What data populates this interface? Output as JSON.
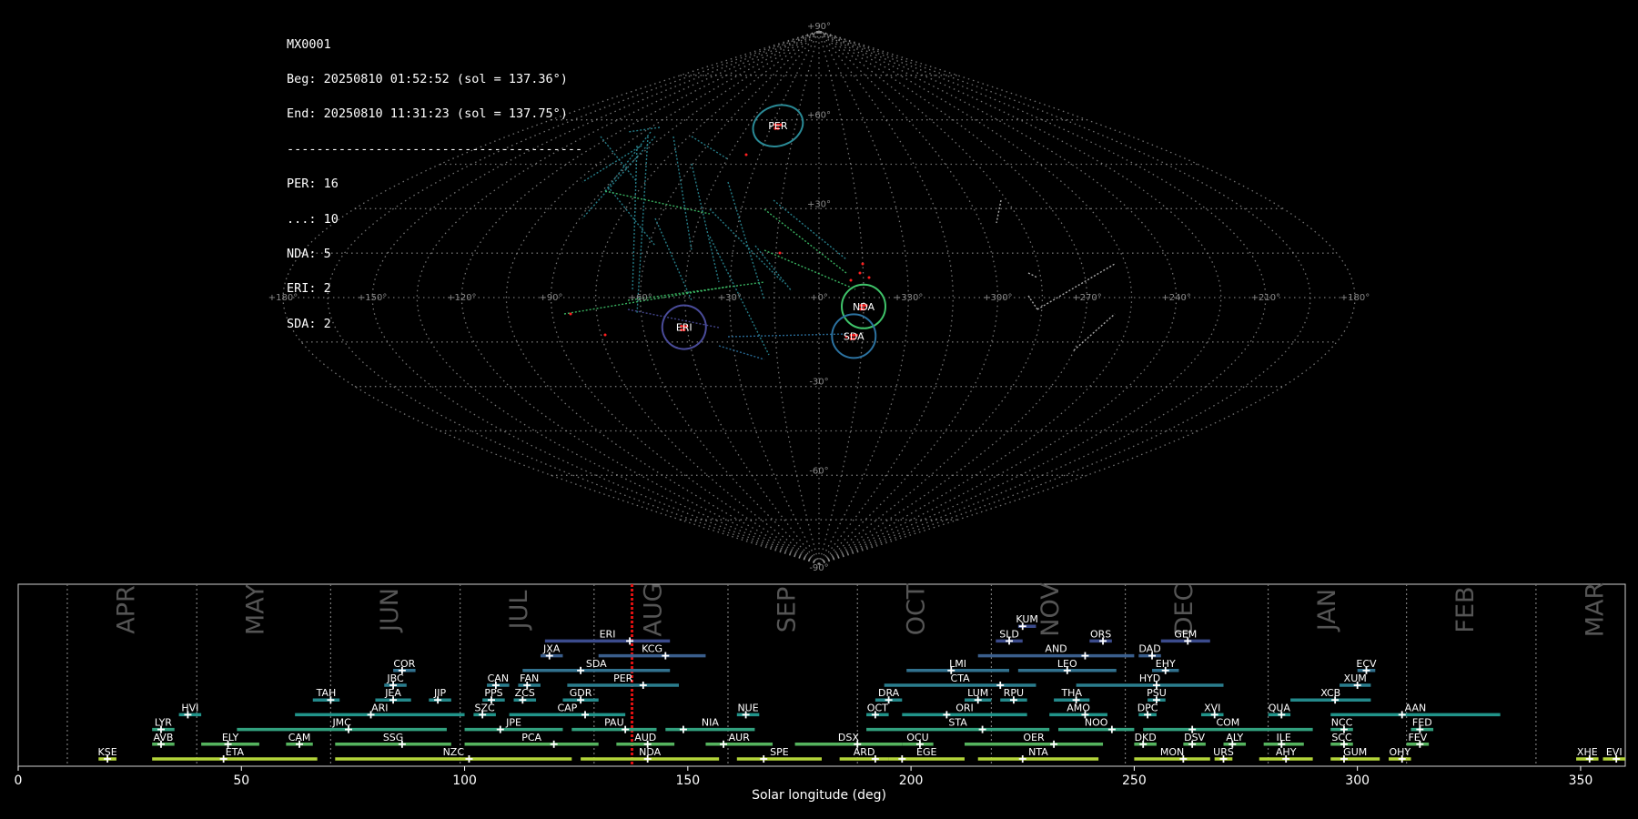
{
  "info": {
    "camera": "MX0001",
    "beg": "Beg: 20250810 01:52:52 (sol = 137.36°)",
    "end": "End: 20250810 11:31:23 (sol = 137.75°)",
    "separator": "----------------------------------------",
    "counts": [
      "PER: 16",
      "...: 10",
      "NDA: 5",
      "ERI: 2",
      "SDA: 2"
    ]
  },
  "chart_data": [
    {
      "type": "scatter",
      "projection": "sinusoidal",
      "lon_ticks": [
        "+180°",
        "+150°",
        "+120°",
        "+90°",
        "+60°",
        "+30°",
        "+0°",
        "+330°",
        "+300°",
        "+270°",
        "+240°",
        "+210°",
        "+180°"
      ],
      "lat_ticks": [
        "+90°",
        "+60°",
        "+30°",
        "-30°",
        "-60°",
        "-90°"
      ],
      "radiants": [
        {
          "code": "PER",
          "lon": 26,
          "lat": 58,
          "color": "#2a8a96"
        },
        {
          "code": "NDA",
          "lon": -15,
          "lat": -3,
          "color": "#3fc46a"
        },
        {
          "code": "ERI",
          "lon": 46,
          "lat": -10,
          "color": "#4a4c9a"
        },
        {
          "code": "SDA",
          "lon": -12,
          "lat": -13,
          "color": "#2c72a0"
        }
      ],
      "colors": {
        "grid": "#9a9a9a",
        "meteor_red": "#ff2020"
      }
    },
    {
      "type": "timeline",
      "xlabel": "Solar longitude (deg)",
      "xlim": [
        0,
        360
      ],
      "xticks": [
        0,
        50,
        100,
        150,
        200,
        250,
        300,
        350
      ],
      "current_sol": 137.5,
      "months": [
        {
          "name": "APR",
          "start": 11
        },
        {
          "name": "MAY",
          "start": 40
        },
        {
          "name": "JUN",
          "start": 70
        },
        {
          "name": "JUL",
          "start": 99
        },
        {
          "name": "AUG",
          "start": 129
        },
        {
          "name": "SEP",
          "start": 159
        },
        {
          "name": "OCT",
          "start": 188
        },
        {
          "name": "NOV",
          "start": 218
        },
        {
          "name": "DEC",
          "start": 248
        },
        {
          "name": "JAN",
          "start": 280
        },
        {
          "name": "FEB",
          "start": 311
        },
        {
          "name": "MAR",
          "start": 340
        }
      ],
      "showers": [
        {
          "code": "KUM",
          "start": 224,
          "end": 228,
          "peak": 225,
          "row": 10,
          "color": "#3b4b8c"
        },
        {
          "code": "ERI",
          "start": 118,
          "end": 146,
          "peak": 137,
          "row": 9,
          "color": "#3b4b8c"
        },
        {
          "code": "SLD",
          "start": 219,
          "end": 225,
          "peak": 222,
          "row": 9,
          "color": "#3b4b8c"
        },
        {
          "code": "ORS",
          "start": 240,
          "end": 245,
          "peak": 243,
          "row": 9,
          "color": "#3b4b8c"
        },
        {
          "code": "GEM",
          "start": 256,
          "end": 267,
          "peak": 262,
          "row": 9,
          "color": "#3b4b8c"
        },
        {
          "code": "JXA",
          "start": 117,
          "end": 122,
          "peak": 119,
          "row": 8,
          "color": "#3a5e8c"
        },
        {
          "code": "KCG",
          "start": 130,
          "end": 154,
          "peak": 145,
          "row": 8,
          "color": "#3a5e8c"
        },
        {
          "code": "AND",
          "start": 215,
          "end": 250,
          "peak": 239,
          "row": 8,
          "color": "#3a5e8c"
        },
        {
          "code": "DAD",
          "start": 251,
          "end": 256,
          "peak": 254,
          "row": 8,
          "color": "#3a5e8c"
        },
        {
          "code": "COR",
          "start": 84,
          "end": 89,
          "peak": 86,
          "row": 7,
          "color": "#31718e"
        },
        {
          "code": "SDA",
          "start": 113,
          "end": 146,
          "peak": 126,
          "row": 7,
          "color": "#31718e"
        },
        {
          "code": "LMI",
          "start": 199,
          "end": 222,
          "peak": 209,
          "row": 7,
          "color": "#31718e"
        },
        {
          "code": "LEO",
          "start": 224,
          "end": 246,
          "peak": 235,
          "row": 7,
          "color": "#31718e"
        },
        {
          "code": "EHY",
          "start": 254,
          "end": 260,
          "peak": 257,
          "row": 7,
          "color": "#31718e"
        },
        {
          "code": "ECV",
          "start": 300,
          "end": 304,
          "peak": 302,
          "row": 7,
          "color": "#31718e"
        },
        {
          "code": "JBC",
          "start": 82,
          "end": 87,
          "peak": 84,
          "row": 6,
          "color": "#2a7d8e"
        },
        {
          "code": "CAN",
          "start": 105,
          "end": 110,
          "peak": 107,
          "row": 6,
          "color": "#2a7d8e"
        },
        {
          "code": "FAN",
          "start": 112,
          "end": 117,
          "peak": 114,
          "row": 6,
          "color": "#2a7d8e"
        },
        {
          "code": "PER",
          "start": 123,
          "end": 148,
          "peak": 140,
          "row": 6,
          "color": "#2a7d8e"
        },
        {
          "code": "CTA",
          "start": 194,
          "end": 228,
          "peak": 220,
          "row": 6,
          "color": "#2a7d8e"
        },
        {
          "code": "HYD",
          "start": 237,
          "end": 270,
          "peak": 255,
          "row": 6,
          "color": "#2a7d8e"
        },
        {
          "code": "XUM",
          "start": 296,
          "end": 303,
          "peak": 300,
          "row": 6,
          "color": "#2a7d8e"
        },
        {
          "code": "TAH",
          "start": 66,
          "end": 72,
          "peak": 70,
          "row": 5,
          "color": "#24898b"
        },
        {
          "code": "JEA",
          "start": 80,
          "end": 88,
          "peak": 84,
          "row": 5,
          "color": "#24898b"
        },
        {
          "code": "JIP",
          "start": 92,
          "end": 97,
          "peak": 94,
          "row": 5,
          "color": "#24898b"
        },
        {
          "code": "PPS",
          "start": 104,
          "end": 109,
          "peak": 106,
          "row": 5,
          "color": "#24898b"
        },
        {
          "code": "ZCS",
          "start": 111,
          "end": 116,
          "peak": 113,
          "row": 5,
          "color": "#24898b"
        },
        {
          "code": "GDR",
          "start": 122,
          "end": 130,
          "peak": 126,
          "row": 5,
          "color": "#24898b"
        },
        {
          "code": "DRA",
          "start": 192,
          "end": 198,
          "peak": 195,
          "row": 5,
          "color": "#24898b"
        },
        {
          "code": "LUM",
          "start": 212,
          "end": 218,
          "peak": 215,
          "row": 5,
          "color": "#24898b"
        },
        {
          "code": "RPU",
          "start": 220,
          "end": 226,
          "peak": 223,
          "row": 5,
          "color": "#24898b"
        },
        {
          "code": "THA",
          "start": 232,
          "end": 240,
          "peak": 237,
          "row": 5,
          "color": "#24898b"
        },
        {
          "code": "PSU",
          "start": 253,
          "end": 257,
          "peak": 255,
          "row": 5,
          "color": "#24898b"
        },
        {
          "code": "XCB",
          "start": 285,
          "end": 303,
          "peak": 295,
          "row": 5,
          "color": "#24898b"
        },
        {
          "code": "HVI",
          "start": 36,
          "end": 41,
          "peak": 38,
          "row": 4,
          "color": "#21948a"
        },
        {
          "code": "ARI",
          "start": 62,
          "end": 100,
          "peak": 79,
          "row": 4,
          "color": "#21948a"
        },
        {
          "code": "SZC",
          "start": 102,
          "end": 107,
          "peak": 104,
          "row": 4,
          "color": "#21948a"
        },
        {
          "code": "CAP",
          "start": 110,
          "end": 136,
          "peak": 127,
          "row": 4,
          "color": "#21948a"
        },
        {
          "code": "NUE",
          "start": 161,
          "end": 166,
          "peak": 163,
          "row": 4,
          "color": "#21948a"
        },
        {
          "code": "OCT",
          "start": 190,
          "end": 195,
          "peak": 192,
          "row": 4,
          "color": "#21948a"
        },
        {
          "code": "ORI",
          "start": 198,
          "end": 226,
          "peak": 208,
          "row": 4,
          "color": "#21948a"
        },
        {
          "code": "AMO",
          "start": 231,
          "end": 244,
          "peak": 239,
          "row": 4,
          "color": "#21948a"
        },
        {
          "code": "DPC",
          "start": 251,
          "end": 255,
          "peak": 253,
          "row": 4,
          "color": "#21948a"
        },
        {
          "code": "XVI",
          "start": 265,
          "end": 270,
          "peak": 268,
          "row": 4,
          "color": "#21948a"
        },
        {
          "code": "QUA",
          "start": 280,
          "end": 285,
          "peak": 283,
          "row": 4,
          "color": "#21948a"
        },
        {
          "code": "AAN",
          "start": 294,
          "end": 332,
          "peak": 310,
          "row": 4,
          "color": "#21948a"
        },
        {
          "code": "LYR",
          "start": 30,
          "end": 35,
          "peak": 32,
          "row": 3,
          "color": "#32a07e"
        },
        {
          "code": "JMC",
          "start": 49,
          "end": 96,
          "peak": 74,
          "row": 3,
          "color": "#32a07e"
        },
        {
          "code": "JPE",
          "start": 100,
          "end": 122,
          "peak": 108,
          "row": 3,
          "color": "#32a07e"
        },
        {
          "code": "PAU",
          "start": 124,
          "end": 143,
          "peak": 136,
          "row": 3,
          "color": "#32a07e"
        },
        {
          "code": "NIA",
          "start": 145,
          "end": 165,
          "peak": 149,
          "row": 3,
          "color": "#32a07e"
        },
        {
          "code": "STA",
          "start": 190,
          "end": 231,
          "peak": 216,
          "row": 3,
          "color": "#32a07e"
        },
        {
          "code": "NOO",
          "start": 233,
          "end": 250,
          "peak": 245,
          "row": 3,
          "color": "#32a07e"
        },
        {
          "code": "COM",
          "start": 252,
          "end": 290,
          "peak": 263,
          "row": 3,
          "color": "#32a07e"
        },
        {
          "code": "NCC",
          "start": 294,
          "end": 299,
          "peak": 297,
          "row": 3,
          "color": "#32a07e"
        },
        {
          "code": "FED",
          "start": 312,
          "end": 317,
          "peak": 314,
          "row": 3,
          "color": "#32a07e"
        },
        {
          "code": "AVB",
          "start": 30,
          "end": 35,
          "peak": 32,
          "row": 2,
          "color": "#55b35e"
        },
        {
          "code": "ELY",
          "start": 41,
          "end": 54,
          "peak": 47,
          "row": 2,
          "color": "#55b35e"
        },
        {
          "code": "CAM",
          "start": 60,
          "end": 66,
          "peak": 63,
          "row": 2,
          "color": "#55b35e"
        },
        {
          "code": "SSG",
          "start": 71,
          "end": 97,
          "peak": 86,
          "row": 2,
          "color": "#55b35e"
        },
        {
          "code": "PCA",
          "start": 100,
          "end": 130,
          "peak": 120,
          "row": 2,
          "color": "#55b35e"
        },
        {
          "code": "AUD",
          "start": 134,
          "end": 147,
          "peak": 141,
          "row": 2,
          "color": "#55b35e"
        },
        {
          "code": "AUR",
          "start": 154,
          "end": 169,
          "peak": 158,
          "row": 2,
          "color": "#55b35e"
        },
        {
          "code": "DSX",
          "start": 174,
          "end": 198,
          "peak": 188,
          "row": 2,
          "color": "#55b35e"
        },
        {
          "code": "OCU",
          "start": 198,
          "end": 205,
          "peak": 202,
          "row": 2,
          "color": "#55b35e"
        },
        {
          "code": "OER",
          "start": 212,
          "end": 243,
          "peak": 232,
          "row": 2,
          "color": "#55b35e"
        },
        {
          "code": "DKD",
          "start": 250,
          "end": 255,
          "peak": 252,
          "row": 2,
          "color": "#55b35e"
        },
        {
          "code": "DSV",
          "start": 261,
          "end": 266,
          "peak": 263,
          "row": 2,
          "color": "#55b35e"
        },
        {
          "code": "ALY",
          "start": 270,
          "end": 275,
          "peak": 272,
          "row": 2,
          "color": "#55b35e"
        },
        {
          "code": "ILE",
          "start": 279,
          "end": 288,
          "peak": 283,
          "row": 2,
          "color": "#55b35e"
        },
        {
          "code": "SCC",
          "start": 294,
          "end": 299,
          "peak": 297,
          "row": 2,
          "color": "#55b35e"
        },
        {
          "code": "FEV",
          "start": 311,
          "end": 316,
          "peak": 314,
          "row": 2,
          "color": "#55b35e"
        },
        {
          "code": "KSE",
          "start": 18,
          "end": 22,
          "peak": 20,
          "row": 1,
          "color": "#b3d43a"
        },
        {
          "code": "ETA",
          "start": 30,
          "end": 67,
          "peak": 46,
          "row": 1,
          "color": "#b3d43a"
        },
        {
          "code": "NZC",
          "start": 71,
          "end": 124,
          "peak": 101,
          "row": 1,
          "color": "#b3d43a"
        },
        {
          "code": "NDA",
          "start": 126,
          "end": 157,
          "peak": 141,
          "row": 1,
          "color": "#b3d43a"
        },
        {
          "code": "SPE",
          "start": 161,
          "end": 180,
          "peak": 167,
          "row": 1,
          "color": "#b3d43a"
        },
        {
          "code": "ARD",
          "start": 184,
          "end": 195,
          "peak": 192,
          "row": 1,
          "color": "#b3d43a"
        },
        {
          "code": "EGE",
          "start": 195,
          "end": 212,
          "peak": 198,
          "row": 1,
          "color": "#b3d43a"
        },
        {
          "code": "NTA",
          "start": 215,
          "end": 242,
          "peak": 225,
          "row": 1,
          "color": "#b3d43a"
        },
        {
          "code": "MON",
          "start": 250,
          "end": 267,
          "peak": 261,
          "row": 1,
          "color": "#b3d43a"
        },
        {
          "code": "URS",
          "start": 268,
          "end": 272,
          "peak": 270,
          "row": 1,
          "color": "#b3d43a"
        },
        {
          "code": "AHY",
          "start": 278,
          "end": 290,
          "peak": 284,
          "row": 1,
          "color": "#b3d43a"
        },
        {
          "code": "GUM",
          "start": 294,
          "end": 305,
          "peak": 297,
          "row": 1,
          "color": "#b3d43a"
        },
        {
          "code": "OHY",
          "start": 307,
          "end": 312,
          "peak": 310,
          "row": 1,
          "color": "#b3d43a"
        },
        {
          "code": "XHE",
          "start": 349,
          "end": 354,
          "peak": 352,
          "row": 1,
          "color": "#b3d43a"
        },
        {
          "code": "EVI",
          "start": 355,
          "end": 360,
          "peak": 358,
          "row": 1,
          "color": "#b3d43a"
        }
      ]
    }
  ]
}
